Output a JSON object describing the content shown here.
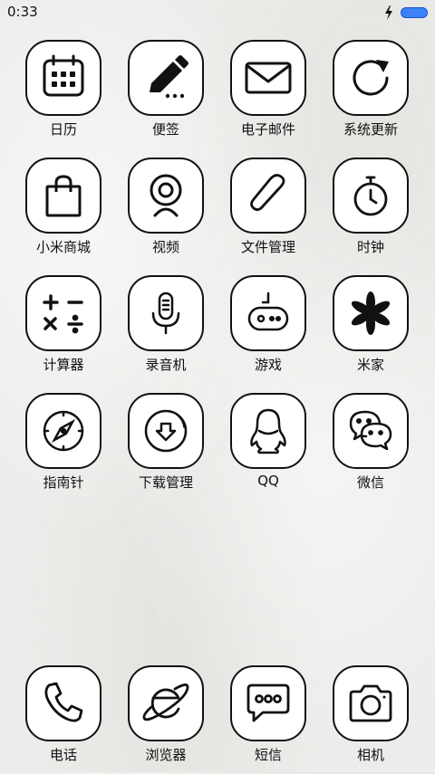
{
  "status_bar": {
    "time": "0:33",
    "charging_icon": "charging-bolt-icon",
    "battery_icon": "battery-icon",
    "battery_color": "#3b82f6"
  },
  "apps": [
    {
      "label": "日历",
      "icon": "calendar-icon"
    },
    {
      "label": "便签",
      "icon": "notes-pencil-icon"
    },
    {
      "label": "电子邮件",
      "icon": "mail-icon"
    },
    {
      "label": "系统更新",
      "icon": "update-icon"
    },
    {
      "label": "小米商城",
      "icon": "shopping-bag-icon"
    },
    {
      "label": "视频",
      "icon": "video-camera-icon"
    },
    {
      "label": "文件管理",
      "icon": "paperclip-icon"
    },
    {
      "label": "时钟",
      "icon": "stopwatch-icon"
    },
    {
      "label": "计算器",
      "icon": "calculator-icon"
    },
    {
      "label": "录音机",
      "icon": "microphone-icon"
    },
    {
      "label": "游戏",
      "icon": "gamepad-icon"
    },
    {
      "label": "米家",
      "icon": "flower-icon"
    },
    {
      "label": "指南针",
      "icon": "compass-icon"
    },
    {
      "label": "下载管理",
      "icon": "download-icon"
    },
    {
      "label": "QQ",
      "icon": "penguin-icon"
    },
    {
      "label": "微信",
      "icon": "wechat-icon"
    }
  ],
  "dock": [
    {
      "label": "电话",
      "icon": "phone-icon"
    },
    {
      "label": "浏览器",
      "icon": "browser-icon"
    },
    {
      "label": "短信",
      "icon": "message-icon"
    },
    {
      "label": "相机",
      "icon": "camera-icon"
    }
  ]
}
